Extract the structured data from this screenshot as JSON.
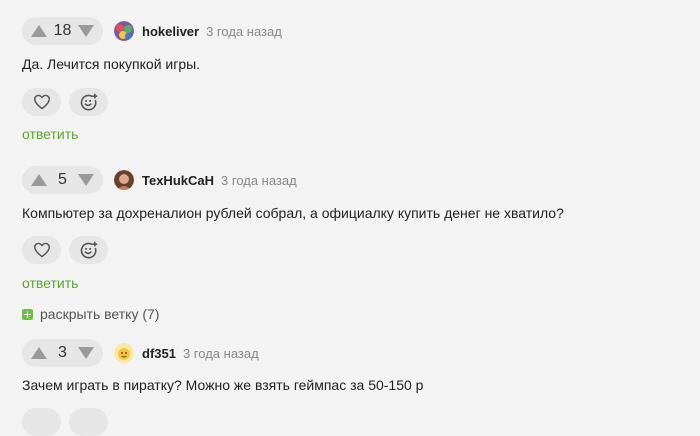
{
  "comments": [
    {
      "votes": "18",
      "username": "hokeliver",
      "time": "3 года назад",
      "text": "Да. Лечится покупкой игры.",
      "reply_label": "ответить",
      "avatar_icon": "avatar-colorful-icon"
    },
    {
      "votes": "5",
      "username": "TexHukCaH",
      "time": "3 года назад",
      "text": "Компьютер за дохреналион рублей собрал, а официалку купить денег не хватило?",
      "reply_label": "ответить",
      "avatar_icon": "avatar-person-icon"
    },
    {
      "votes": "3",
      "username": "df351",
      "time": "3 года назад",
      "text": "Зачем играть в пиратку? Можно же взять геймпас за 50-150 р",
      "avatar_icon": "avatar-yellow-icon"
    }
  ],
  "expand_thread_label": "раскрыть ветку (7)",
  "colors": {
    "background": "#f3f3f3",
    "accent_green": "#5aa62f",
    "pill_gray": "#e6e6e6",
    "arrow_gray": "#999999"
  }
}
